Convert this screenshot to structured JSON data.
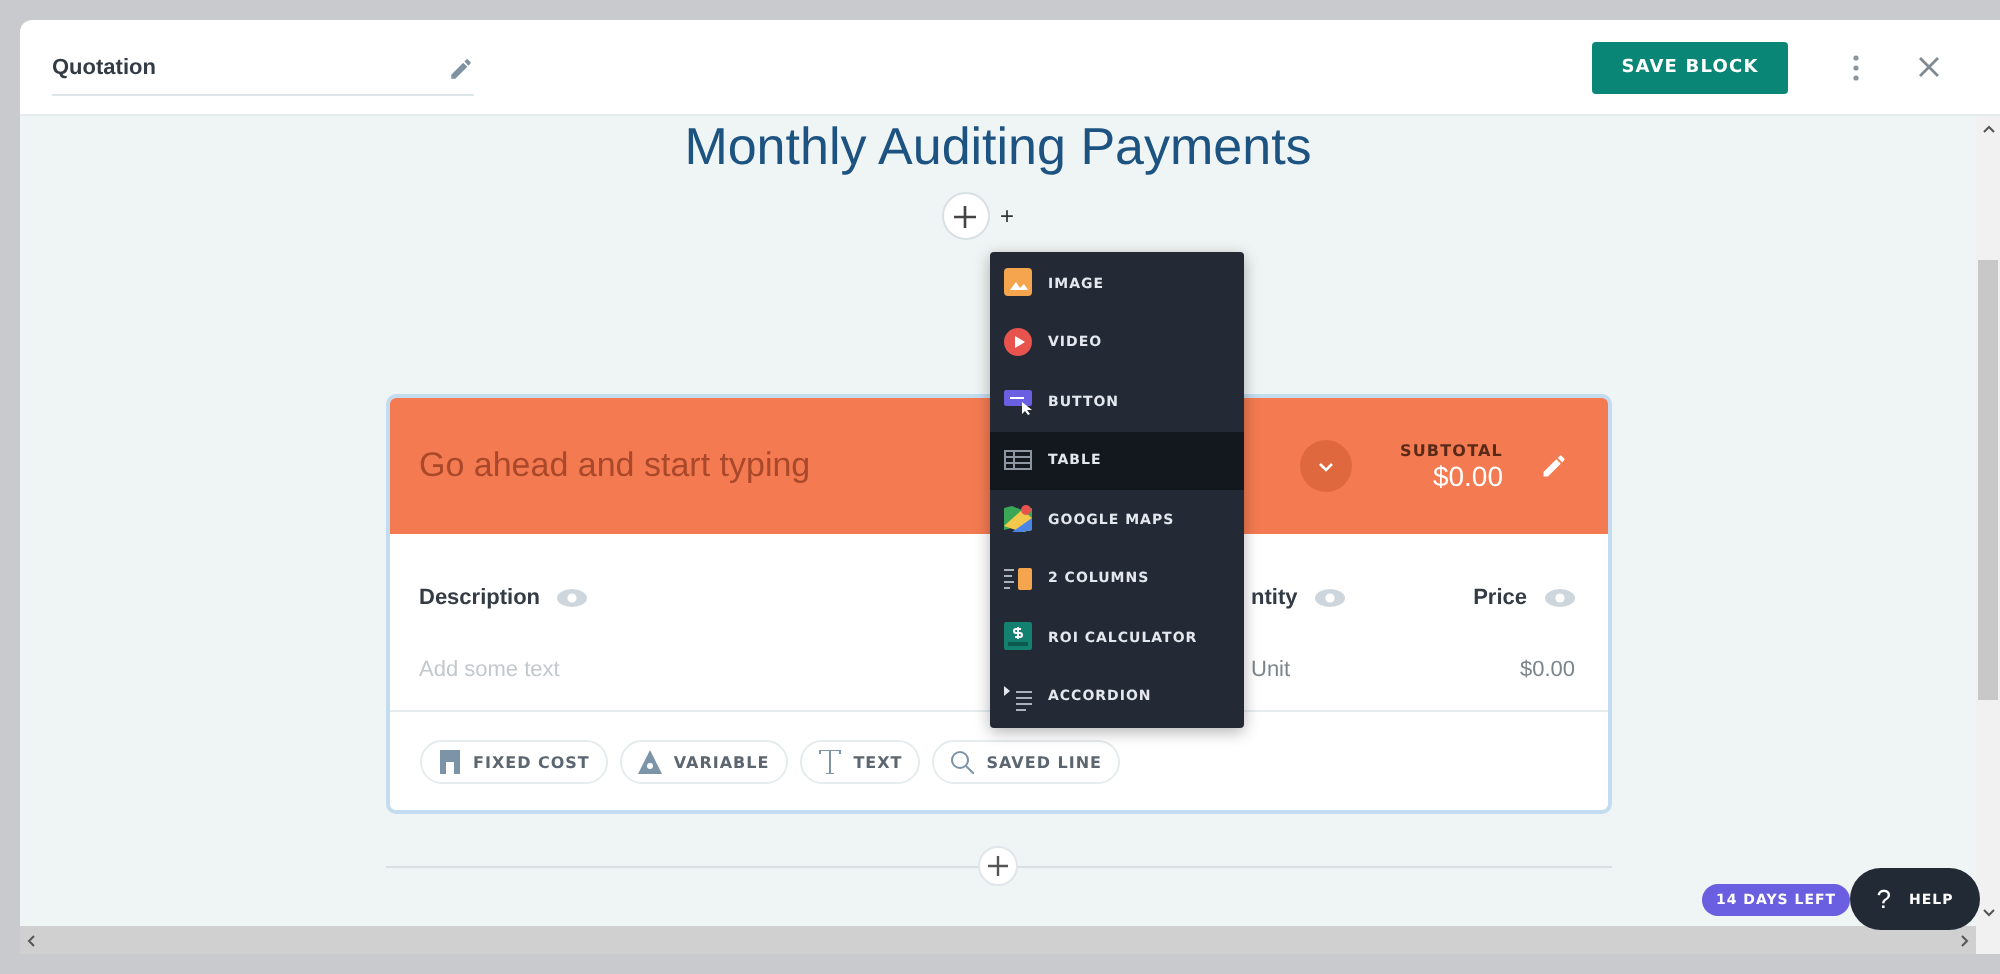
{
  "header": {
    "title": "Quotation",
    "save_button": "SAVE BLOCK"
  },
  "page_title": "Monthly Auditing Payments",
  "add_marker": "+",
  "insert_menu": [
    {
      "label": "IMAGE",
      "selected": false
    },
    {
      "label": "VIDEO",
      "selected": false
    },
    {
      "label": "BUTTON",
      "selected": false
    },
    {
      "label": "TABLE",
      "selected": true
    },
    {
      "label": "GOOGLE MAPS",
      "selected": false
    },
    {
      "label": "2 COLUMNS",
      "selected": false
    },
    {
      "label": "ROI CALCULATOR",
      "selected": false
    },
    {
      "label": "ACCORDION",
      "selected": false
    }
  ],
  "card": {
    "title_placeholder": "Go ahead and start typing",
    "subtotal_label": "SUBTOTAL",
    "subtotal": "$0.00",
    "columns": [
      "Description",
      "ntity",
      "Price"
    ],
    "row": {
      "description_placeholder": "Add some text",
      "quantity": "Unit",
      "price": "$0.00"
    },
    "add_buttons": [
      "FIXED COST",
      "VARIABLE",
      "TEXT",
      "SAVED LINE"
    ]
  },
  "trial_badge": "14 DAYS LEFT",
  "help_button": {
    "icon": "?",
    "label": "HELP"
  }
}
